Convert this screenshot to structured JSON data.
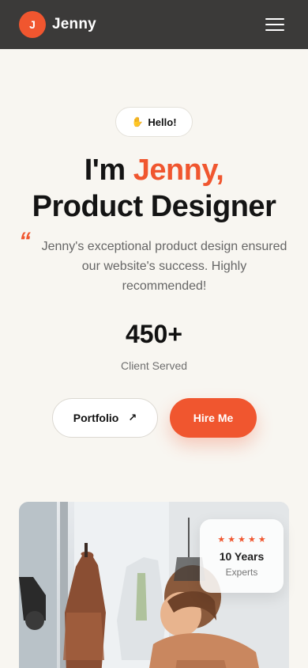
{
  "header": {
    "logo_letter": "J",
    "brand_name": "Jenny"
  },
  "hero": {
    "greeting": "Hello!",
    "headline_prefix": "I'm ",
    "headline_name": "Jenny,",
    "headline_role": "Product Designer",
    "quote_mark": "“",
    "testimonial": "Jenny's exceptional product design ensured our website's success. Highly recommended!",
    "stat_value": "450+",
    "stat_label": "Client Served",
    "portfolio_label": "Portfolio",
    "portfolio_arrow": "↗",
    "hire_label": "Hire Me"
  },
  "experience_card": {
    "stars": [
      "★",
      "★",
      "★",
      "★",
      "★"
    ],
    "years": "10 Years",
    "label": "Experts"
  },
  "icons": {
    "menu": "hamburger-menu-icon",
    "arrow": "arrow-up-right-icon",
    "wave": "waving-hand-icon",
    "star": "star-icon"
  },
  "colors": {
    "accent": "#f0562f",
    "header_bg": "#3b3a39",
    "page_bg": "#f8f6f1"
  }
}
